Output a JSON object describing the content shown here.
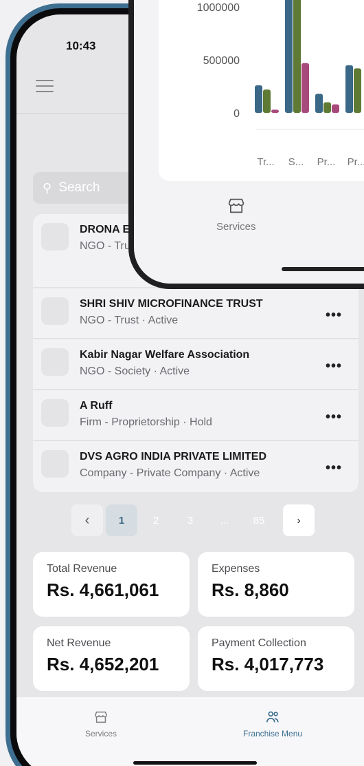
{
  "back_phone": {
    "status_time": "10:43",
    "search": {
      "placeholder": "Search"
    },
    "entities": [
      {
        "name": "DRONA E… CHERITAB…",
        "subtitle": "NGO - Trust"
      },
      {
        "name": "SHRI SHIV MICROFINANCE TRUST",
        "subtitle": "NGO - Trust · Active"
      },
      {
        "name": "Kabir Nagar Welfare Association",
        "subtitle": "NGO - Society · Active"
      },
      {
        "name": "A Ruff",
        "subtitle": "Firm - Proprietorship · Hold"
      },
      {
        "name": "DVS AGRO INDIA PRIVATE LIMITED",
        "subtitle": "Company - Private Company · Active"
      }
    ],
    "more_label": "•••",
    "pagination": {
      "prev": "‹",
      "pages": [
        "1",
        "2",
        "3",
        "...",
        "85"
      ],
      "current": "1",
      "next": "›"
    },
    "stats": [
      {
        "label": "Total Revenue",
        "value": "Rs. 4,661,061"
      },
      {
        "label": "Expenses",
        "value": "Rs. 8,860"
      },
      {
        "label": "Net Revenue",
        "value": "Rs. 4,652,201"
      },
      {
        "label": "Payment Collection",
        "value": "Rs. 4,017,773"
      }
    ],
    "tabs": {
      "services": "Services",
      "franchise": "Franchise Menu"
    },
    "colors": {
      "accent": "#3e6f90",
      "frame": "#3e6f90"
    }
  },
  "front_phone": {
    "tab_label": "Services"
  },
  "chart_data": {
    "type": "bar",
    "title": "",
    "xlabel": "",
    "ylabel": "",
    "ylim": [
      0,
      1000000
    ],
    "yticks": [
      "1000000",
      "500000",
      "0"
    ],
    "categories": [
      "Tr...",
      "S...",
      "Pr...",
      "Pr..."
    ],
    "series": [
      {
        "color": "#3a6886",
        "values": [
          260000,
          1200000,
          180000,
          450000
        ]
      },
      {
        "color": "#5e7a35",
        "values": [
          220000,
          1200000,
          100000,
          420000
        ]
      },
      {
        "color": "#a8497c",
        "values": [
          30000,
          470000,
          80000,
          0
        ]
      }
    ]
  }
}
